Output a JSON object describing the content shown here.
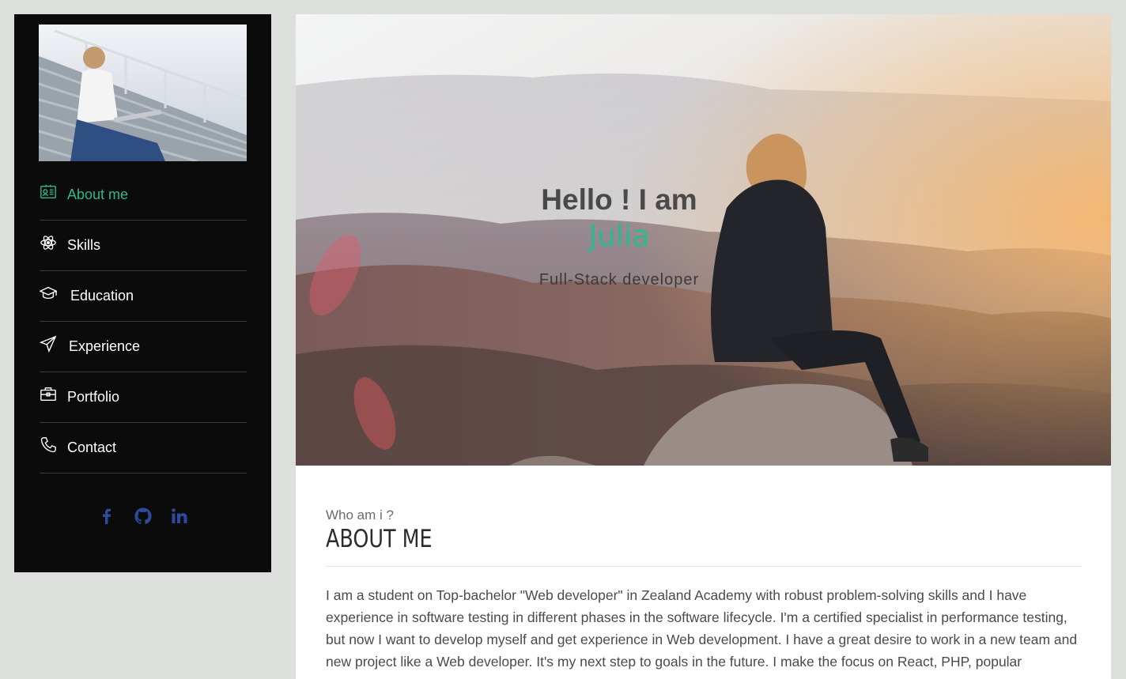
{
  "sidebar": {
    "nav": [
      {
        "label": "About me",
        "icon": "contact-card-icon",
        "active": true
      },
      {
        "label": "Skills",
        "icon": "atom-icon",
        "active": false
      },
      {
        "label": "Education",
        "icon": "graduation-cap-icon",
        "active": false
      },
      {
        "label": "Experience",
        "icon": "paper-plane-icon",
        "active": false
      },
      {
        "label": "Portfolio",
        "icon": "briefcase-icon",
        "active": false
      },
      {
        "label": "Contact",
        "icon": "phone-icon",
        "active": false
      }
    ],
    "social": [
      "facebook-icon",
      "github-icon",
      "linkedin-icon"
    ],
    "social_color": "#2f4a9c",
    "accent": "#2fb890"
  },
  "hero": {
    "greeting": "Hello ! I am",
    "name": "Julia",
    "role": "Full-Stack developer"
  },
  "about": {
    "subtitle": "Who am i ?",
    "title": "ABOUT ME",
    "text": "I am a student on Top-bachelor \"Web developer\" in Zealand Academy with robust problem-solving skills and I have experience in software testing in different phases in the software lifecycle. I'm a certified specialist in performance testing, but now I want to develop myself and get experience in Web development. I have a great desire to work in a new team and new project like a Web developer. It's my next step to goals in the future. I make the focus on React, PHP, popular"
  }
}
